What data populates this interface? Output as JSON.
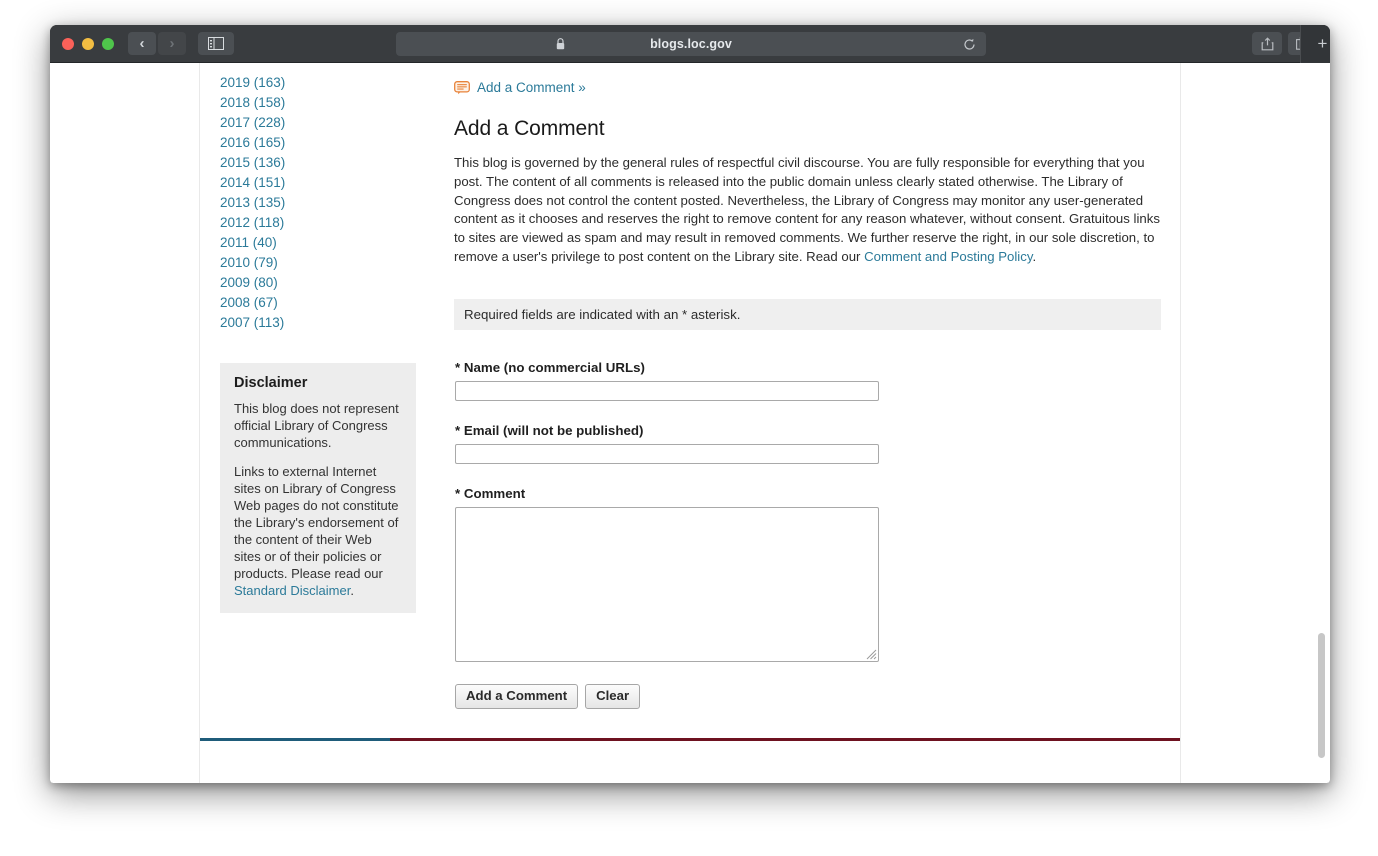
{
  "browser": {
    "url": "blogs.loc.gov",
    "lock_icon": "lock-icon",
    "reload_icon": "reload-icon",
    "back_icon": "chevron-left-icon",
    "forward_icon": "chevron-right-icon",
    "sidebar_icon": "sidebar-toggle-icon",
    "share_icon": "share-icon",
    "tabs_icon": "show-tabs-icon",
    "newtab_label": "+",
    "traffic_lights": {
      "close": "#fa6159",
      "minimize": "#f2bd42",
      "maximize": "#4fc54b"
    }
  },
  "sidebar": {
    "archives": [
      {
        "label": "2019 (163)"
      },
      {
        "label": "2018 (158)"
      },
      {
        "label": "2017 (228)"
      },
      {
        "label": "2016 (165)"
      },
      {
        "label": "2015 (136)"
      },
      {
        "label": "2014 (151)"
      },
      {
        "label": "2013 (135)"
      },
      {
        "label": "2012 (118)"
      },
      {
        "label": "2011 (40)"
      },
      {
        "label": "2010 (79)"
      },
      {
        "label": "2009 (80)"
      },
      {
        "label": "2008 (67)"
      },
      {
        "label": "2007 (113)"
      }
    ],
    "disclaimer": {
      "title": "Disclaimer",
      "paragraph1": "This blog does not represent official Library of Congress communications.",
      "paragraph2_before_link": "Links to external Internet sites on Library of Congress Web pages do not constitute the Library's endorsement of the content of their Web sites or of their policies or products. Please read our ",
      "link_label": "Standard Disclaimer",
      "paragraph2_after_link": "."
    }
  },
  "main": {
    "comment_anchor_label": "Add a Comment »",
    "comment_bubble_icon": "comment-bubble-icon",
    "page_title": "Add a Comment",
    "intro_before_link": "This blog is governed by the general rules of respectful civil discourse. You are fully responsible for everything that you post. The content of all comments is released into the public domain unless clearly stated otherwise. The Library of Congress does not control the content posted. Nevertheless, the Library of Congress may monitor any user-generated content as it chooses and reserves the right to remove content for any reason whatever, without consent. Gratuitous links to sites are viewed as spam and may result in removed comments. We further reserve the right, in our sole discretion, to remove a user's privilege to post content on the Library site. Read our ",
    "intro_link_label": "Comment and Posting Policy",
    "intro_after_link": ".",
    "required_notice": "Required fields are indicated with an * asterisk.",
    "form": {
      "name_label": "* Name (no commercial URLs)",
      "name_value": "",
      "email_label": "* Email (will not be published)",
      "email_value": "",
      "comment_label": "* Comment",
      "comment_value": "",
      "submit_label": "Add a Comment",
      "clear_label": "Clear"
    }
  },
  "footer": {
    "rule_blue": "#1f5c7a",
    "rule_red": "#6e1220"
  }
}
